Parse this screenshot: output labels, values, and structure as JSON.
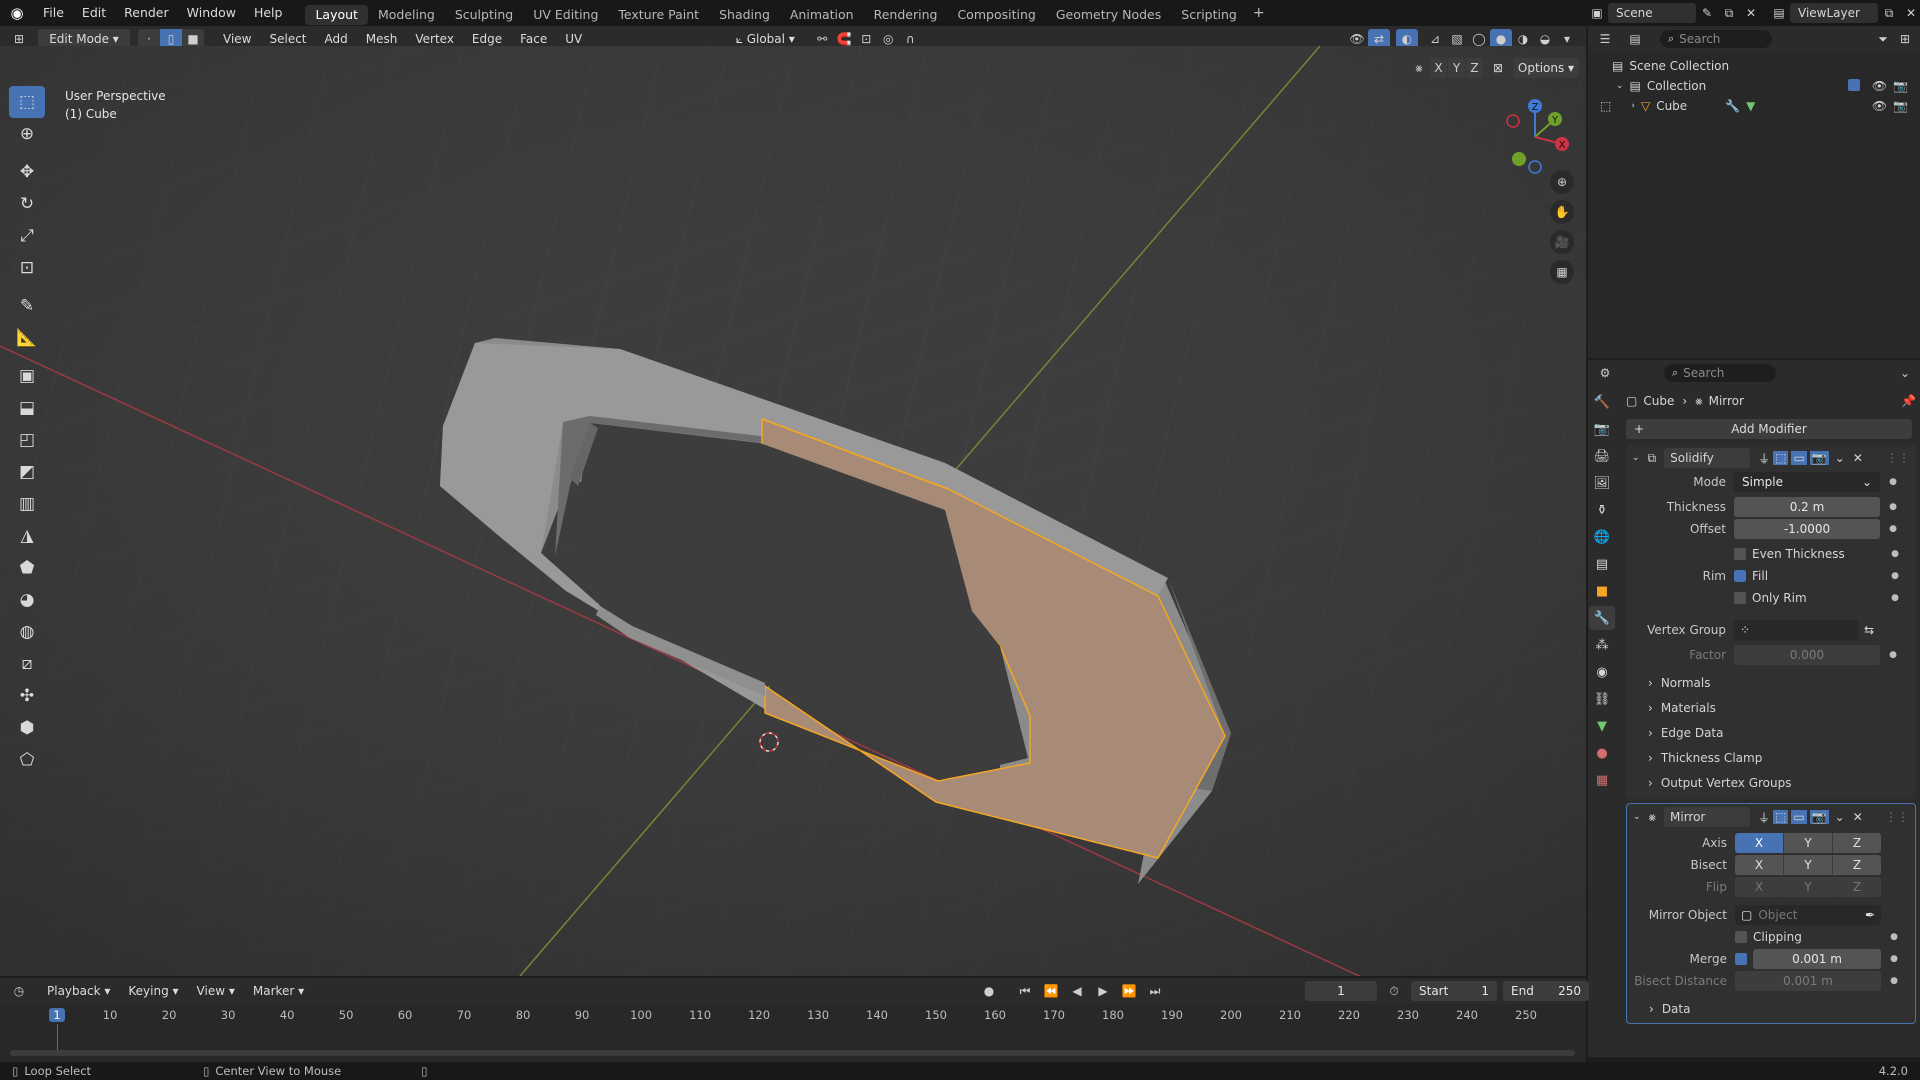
{
  "menu": [
    "File",
    "Edit",
    "Render",
    "Window",
    "Help"
  ],
  "workspaces": [
    "Layout",
    "Modeling",
    "Sculpting",
    "UV Editing",
    "Texture Paint",
    "Shading",
    "Animation",
    "Rendering",
    "Compositing",
    "Geometry Nodes",
    "Scripting"
  ],
  "active_workspace": "Layout",
  "scene_name": "Scene",
  "view_layer": "ViewLayer",
  "viewport_header": {
    "mode": "Edit Mode",
    "menus": [
      "View",
      "Select",
      "Add",
      "Mesh",
      "Vertex",
      "Edge",
      "Face",
      "UV"
    ],
    "transform_orientation": "Global",
    "axes": [
      "X",
      "Y",
      "Z"
    ],
    "options_label": "Options"
  },
  "viewport": {
    "view_name": "User Perspective",
    "object_label": "(1) Cube",
    "gizmo": {
      "x": "X",
      "y": "Y",
      "z": "Z"
    }
  },
  "outliner": {
    "search_placeholder": "Search",
    "scene_collection": "Scene Collection",
    "collection": "Collection",
    "object": "Cube"
  },
  "properties": {
    "search_placeholder": "Search",
    "breadcrumb_object": "Cube",
    "breadcrumb_modifier": "Mirror",
    "add_modifier": "Add Modifier",
    "solidify": {
      "name": "Solidify",
      "mode_label": "Mode",
      "mode_value": "Simple",
      "thickness_label": "Thickness",
      "thickness_value": "0.2 m",
      "offset_label": "Offset",
      "offset_value": "-1.0000",
      "even_thickness": "Even Thickness",
      "rim_label": "Rim",
      "fill_label": "Fill",
      "only_rim": "Only Rim",
      "vertex_group_label": "Vertex Group",
      "factor_label": "Factor",
      "factor_value": "0.000",
      "subpanels": [
        "Normals",
        "Materials",
        "Edge Data",
        "Thickness Clamp",
        "Output Vertex Groups"
      ]
    },
    "mirror": {
      "name": "Mirror",
      "axis_label": "Axis",
      "bisect_label": "Bisect",
      "flip_label": "Flip",
      "axes": [
        "X",
        "Y",
        "Z"
      ],
      "mirror_object_label": "Mirror Object",
      "mirror_object_placeholder": "Object",
      "clipping_label": "Clipping",
      "merge_label": "Merge",
      "merge_value": "0.001 m",
      "bisect_distance_label": "Bisect Distance",
      "bisect_distance_value": "0.001 m",
      "data_label": "Data"
    }
  },
  "timeline": {
    "menus": [
      "Playback",
      "Keying",
      "View",
      "Marker"
    ],
    "current_frame": "1",
    "start_label": "Start",
    "start_value": "1",
    "end_label": "End",
    "end_value": "250",
    "ticks": [
      "1",
      "10",
      "20",
      "30",
      "40",
      "50",
      "60",
      "70",
      "80",
      "90",
      "100",
      "110",
      "120",
      "130",
      "140",
      "150",
      "160",
      "170",
      "180",
      "190",
      "200",
      "210",
      "220",
      "230",
      "240",
      "250"
    ]
  },
  "statusbar": {
    "left": "Loop Select",
    "middle": "Center View to Mouse",
    "version": "4.2.0"
  },
  "colors": {
    "accent": "#4772b3",
    "face_fill": "#a88b76",
    "selection": "#f5a623",
    "x_axis": "#cc3344",
    "y_axis": "#6fa02a"
  }
}
